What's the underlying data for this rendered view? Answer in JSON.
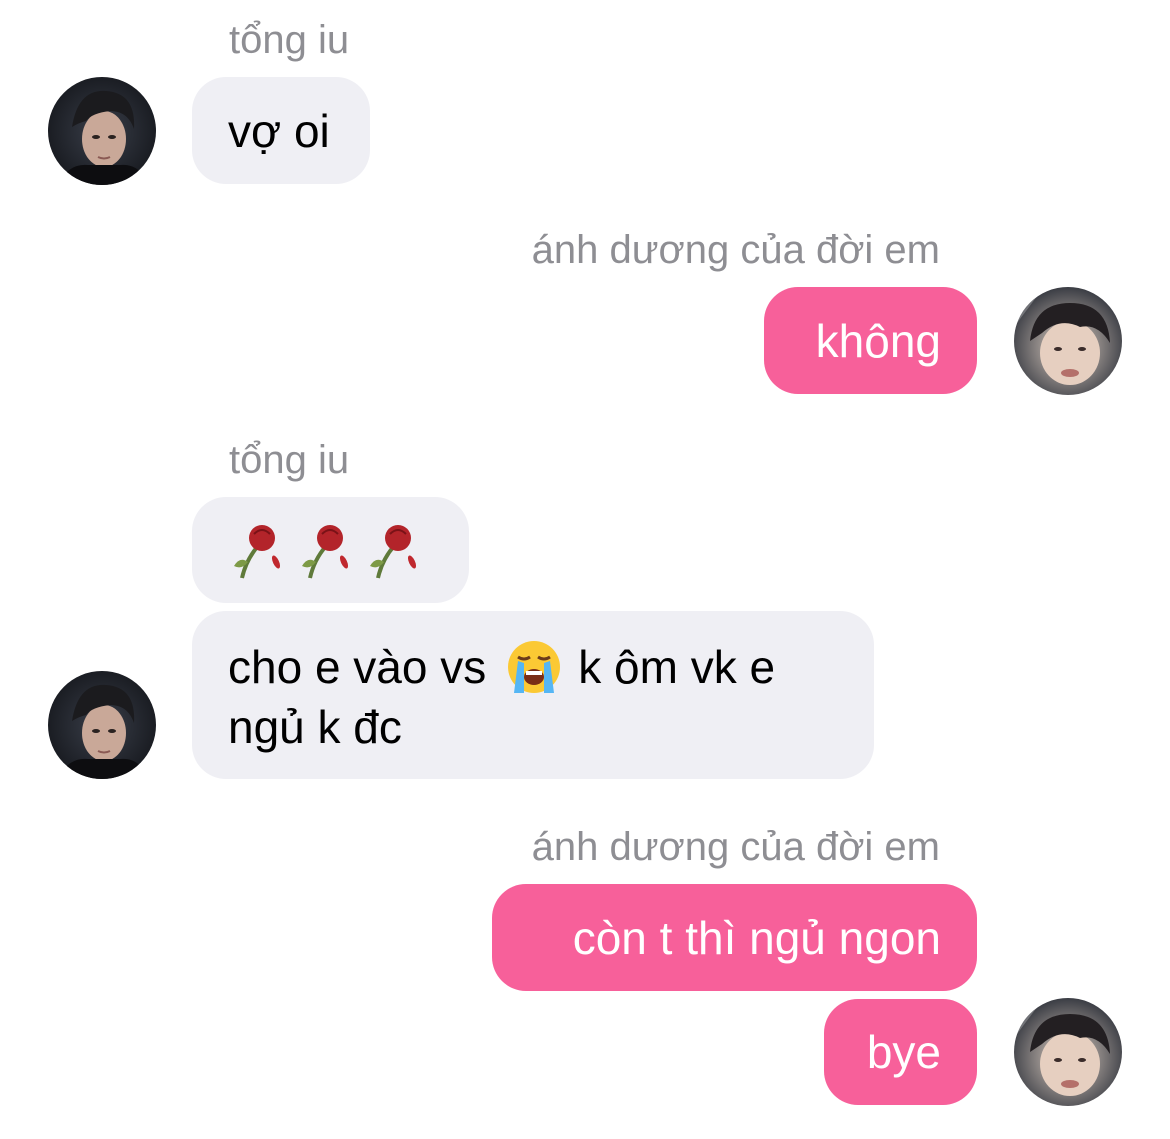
{
  "messages": [
    {
      "sender": "tổng iu",
      "text": "vợ oi"
    },
    {
      "sender": "ánh dương của đời em",
      "text": "không"
    },
    {
      "sender": "tổng iu",
      "text": "🥀🥀🥀"
    },
    {
      "text_before": "cho e vào vs",
      "emoji": "😭",
      "text_after": "k ôm vk e",
      "line2": "ngủ k đc"
    },
    {
      "sender": "ánh dương của đời em",
      "text": "còn t thì ngủ ngon"
    },
    {
      "text": "bye"
    }
  ],
  "icons": {
    "rose": "wilted-rose-icon",
    "cry": "loudly-crying-face-icon"
  },
  "colors": {
    "incoming_bubble": "#efeff4",
    "outgoing_bubble": "#f7609a",
    "sender_name": "#8e8e93"
  }
}
